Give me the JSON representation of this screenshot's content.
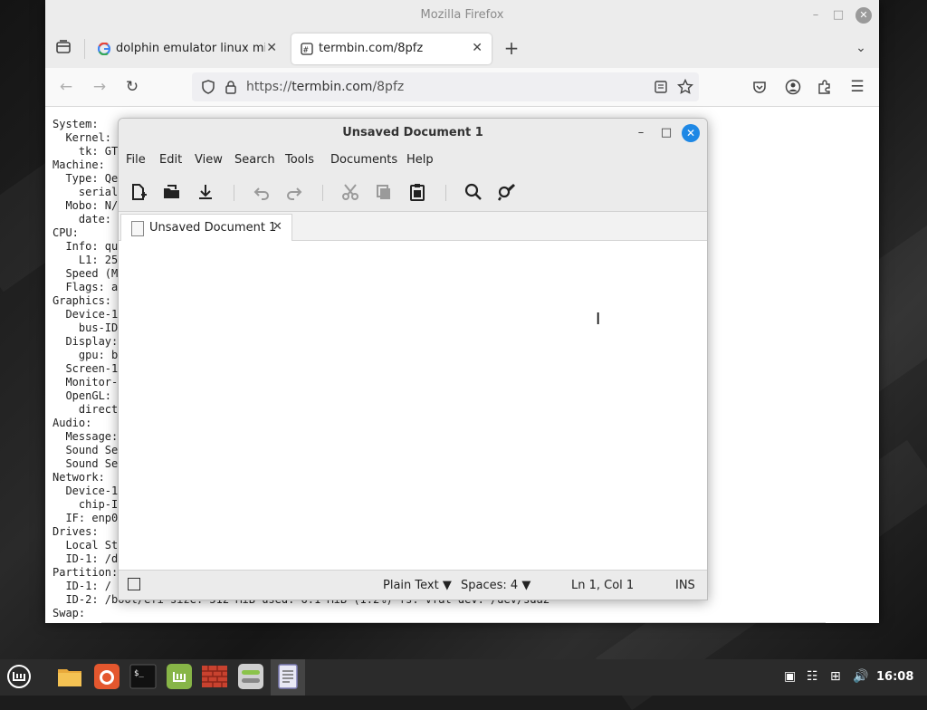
{
  "firefox": {
    "window_title": "Mozilla Firefox",
    "tabs": [
      {
        "label": "dolphin emulator linux mint"
      },
      {
        "label": "termbin.com/8pfz"
      }
    ],
    "url": {
      "scheme": "https://",
      "host": "termbin.com",
      "path": "/8pfz"
    },
    "page_lines": [
      "System:",
      "  Kernel:",
      "    tk: GT",
      "Machine:",
      "  Type: Qe",
      "    serial",
      "  Mobo: N/",
      "    date:",
      "CPU:",
      "  Info: qu",
      "    L1: 25",
      "  Speed (M",
      "  Flags: a",
      "Graphics:",
      "  Device-1",
      "    bus-ID",
      "  Display:",
      "    gpu: b",
      "  Screen-1",
      "  Monitor-",
      "  OpenGL:",
      "    direct",
      "Audio:",
      "  Message:",
      "  Sound Se",
      "  Sound Se",
      "Network:",
      "  Device-1",
      "    chip-I",
      "  IF: enp0",
      "Drives:",
      "  Local St",
      "  ID-1: /d",
      "Partition:",
      "  ID-1: /",
      "  ID-2: /boot/efi size: 512 MiB used: 6.1 MiB (1.2%) fs: vfat dev: /dev/sda2",
      "Swap:"
    ]
  },
  "editor": {
    "window_title": "Unsaved Document 1",
    "menu": [
      "File",
      "Edit",
      "View",
      "Search",
      "Tools",
      "Documents",
      "Help"
    ],
    "tab_label": "Unsaved Document 1",
    "status": {
      "syntax": "Plain Text",
      "indent": "Spaces: 4",
      "position": "Ln 1, Col 1",
      "mode": "INS"
    }
  },
  "panel": {
    "clock": "16:08",
    "launchers": [
      "mint-menu-icon",
      "files-icon",
      "firefox-icon",
      "terminal-icon",
      "mintinstall-icon",
      "firewall-icon",
      "settings-icon",
      "text-editor-icon"
    ]
  }
}
